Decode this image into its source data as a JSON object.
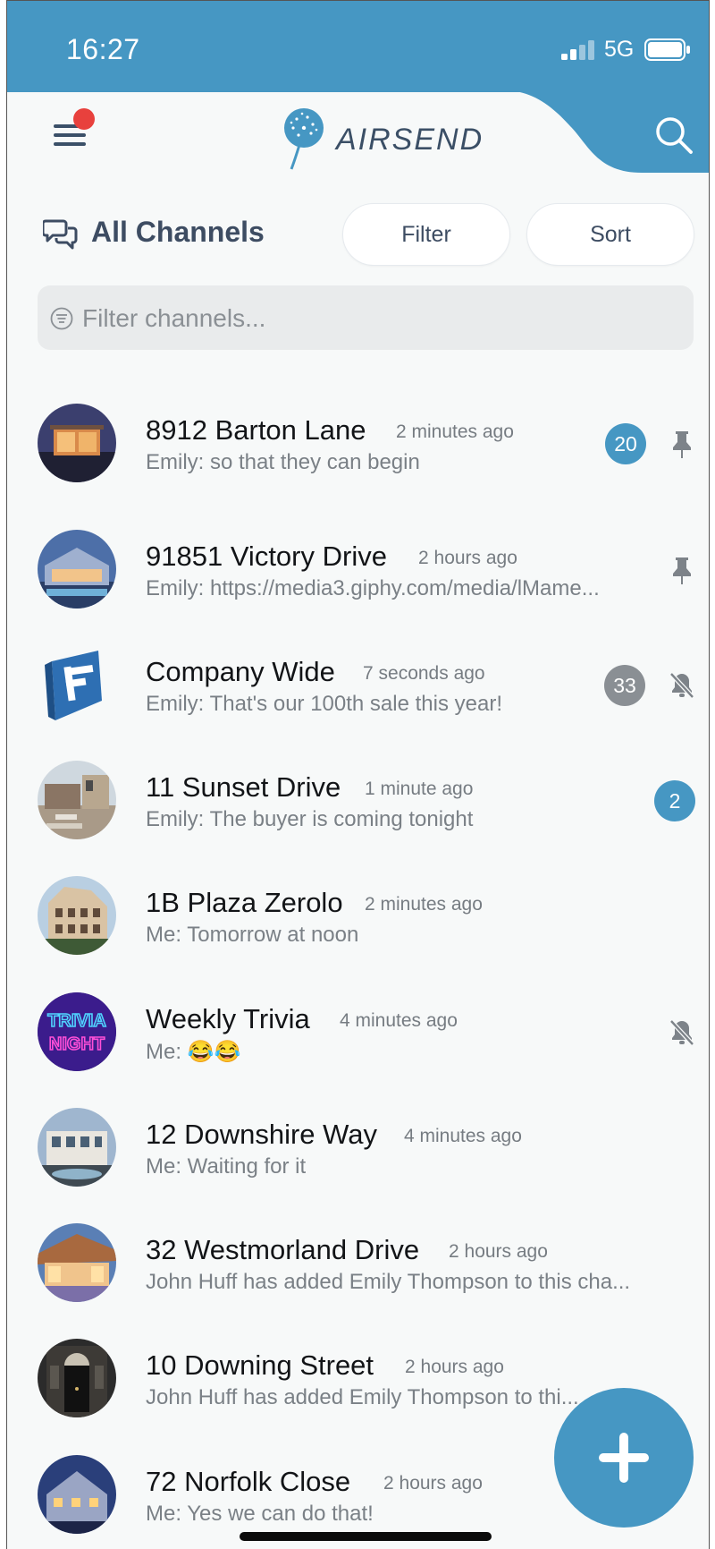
{
  "status_bar": {
    "time": "16:27",
    "network": "5G"
  },
  "header": {
    "logo_text": "AIRSEND",
    "search_icon": "search-icon",
    "menu_icon": "hamburger-icon"
  },
  "section": {
    "title": "All Channels",
    "filter_label": "Filter",
    "sort_label": "Sort"
  },
  "search": {
    "placeholder": "Filter channels..."
  },
  "colors": {
    "accent": "#4697c3",
    "muted_badge": "#8a8f94",
    "notification_dot": "#e8413d"
  },
  "channels": [
    {
      "name": "8912 Barton Lane",
      "time": "2 minutes ago",
      "message": "Emily: so that they can begin",
      "badge": "20",
      "badge_style": "blue",
      "status_icon": "pin-icon"
    },
    {
      "name": "91851 Victory Drive",
      "time": "2 hours ago",
      "message": "Emily: https://media3.giphy.com/media/lMame...",
      "badge": "",
      "status_icon": "pin-icon"
    },
    {
      "name": "Company Wide",
      "time": "7 seconds ago",
      "message": "Emily: That's our 100th sale this year!",
      "badge": "33",
      "badge_style": "grey",
      "status_icon": "muted-icon"
    },
    {
      "name": "11 Sunset Drive",
      "time": "1 minute ago",
      "message": "Emily: The buyer is coming tonight",
      "badge": "2",
      "badge_style": "blue",
      "status_icon": ""
    },
    {
      "name": "1B Plaza Zerolo",
      "time": "2 minutes ago",
      "message": "Me: Tomorrow at noon",
      "badge": "",
      "status_icon": ""
    },
    {
      "name": "Weekly Trivia",
      "time": "4 minutes ago",
      "message": "Me: 😂😂",
      "badge": "",
      "status_icon": "muted-icon",
      "avatar_text_1": "TRIVIA",
      "avatar_text_2": "NIGHT"
    },
    {
      "name": "12 Downshire Way",
      "time": "4 minutes ago",
      "message": "Me: Waiting for it",
      "badge": "",
      "status_icon": ""
    },
    {
      "name": "32 Westmorland Drive",
      "time": "2 hours ago",
      "message": "John Huff has added Emily Thompson to this cha...",
      "badge": "",
      "status_icon": ""
    },
    {
      "name": "10 Downing Street",
      "time": "2 hours ago",
      "message": "John Huff has added Emily Thompson to thi...",
      "badge": "",
      "status_icon": ""
    },
    {
      "name": "72 Norfolk Close",
      "time": "2 hours ago",
      "message": "Me: Yes we can do that!",
      "badge": "",
      "status_icon": ""
    }
  ],
  "fab": {
    "icon": "plus-icon"
  }
}
